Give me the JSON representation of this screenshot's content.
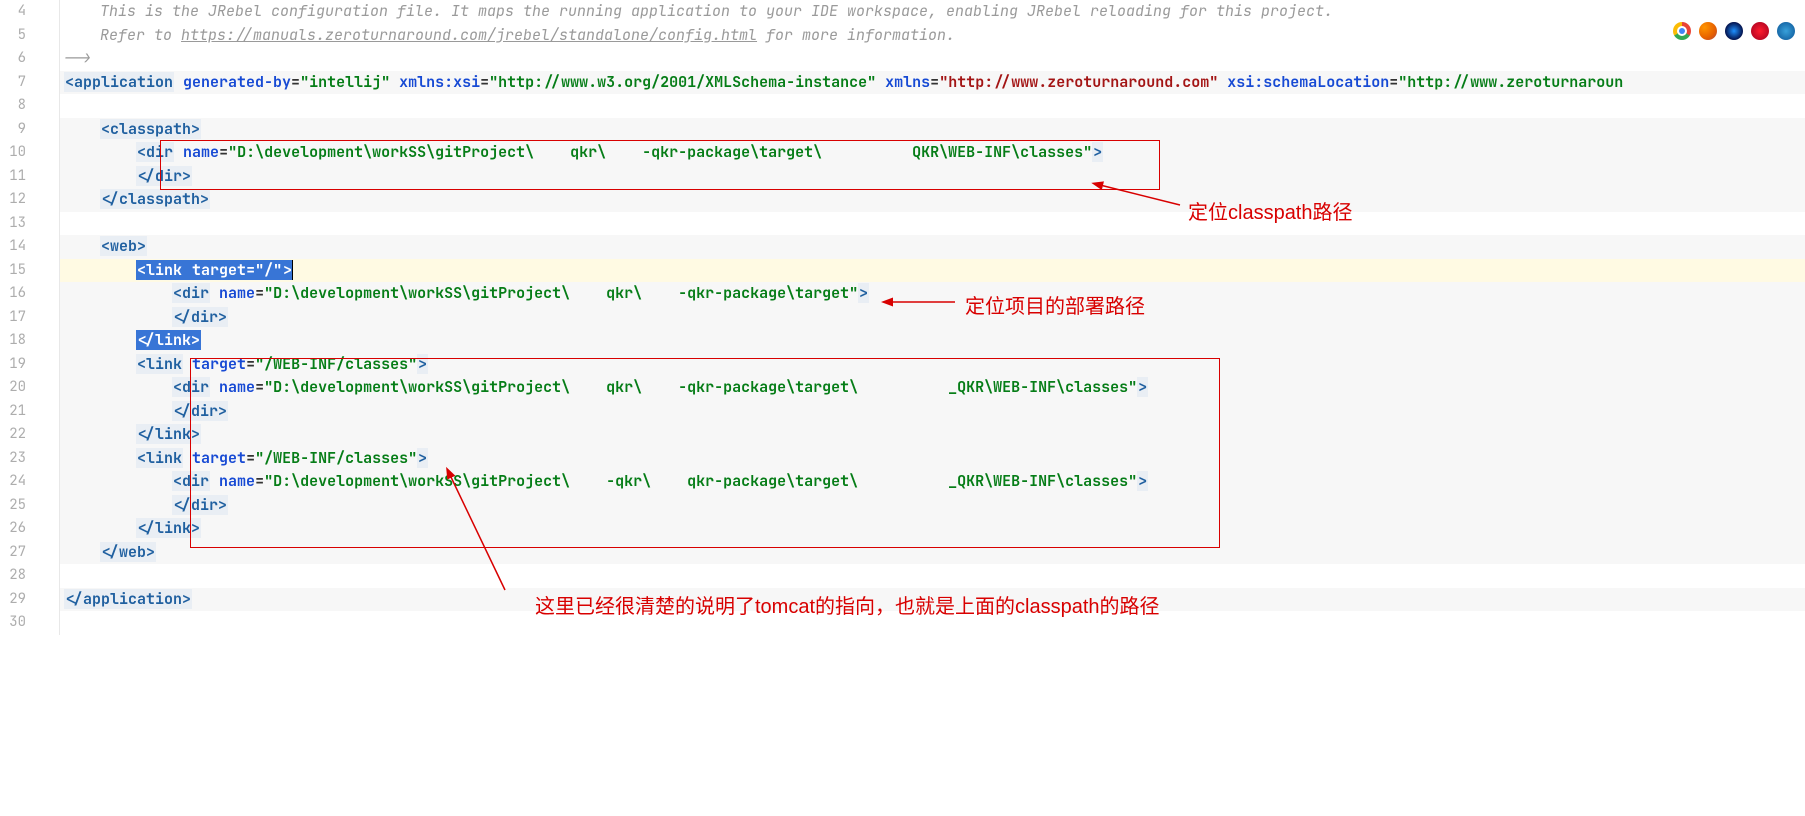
{
  "lines": {
    "start": 4,
    "end": 30
  },
  "comment": {
    "l4": "This is the JRebel configuration file. It maps the running application to your IDE workspace, enabling JRebel reloading for this project.",
    "l5a": "Refer to ",
    "l5link": "https://manuals.zeroturnaround.com/jrebel/standalone/config.html",
    "l5b": " for more information.",
    "l6": "-->"
  },
  "app": {
    "open": "<application",
    "gen_attr": "generated-by",
    "gen_val": "\"intellij\"",
    "xsi_attr": "xmlns:xsi",
    "xsi_val": "\"http://www.w3.org/2001/XMLSchema-instance\"",
    "xmlns_attr": "xmlns",
    "xmlns_val": "\"http://www.zeroturnaround.com\"",
    "loc_attr": "xsi:schemaLocation",
    "loc_val": "\"http://www.zeroturnaroun",
    "close": "</application>"
  },
  "cp": {
    "open": "<classpath>",
    "close": "</classpath>",
    "dir_open": "<dir",
    "name_attr": "name",
    "name_val": "\"D:\\development\\workSS\\gitProject\\    qkr\\    -qkr-package\\target\\          QKR\\WEB-INF\\classes\"",
    "dir_end": ">",
    "dir_close": "</dir>"
  },
  "web": {
    "open": "<web>",
    "close": "</web>",
    "link1_open": "<link",
    "target_attr": "target",
    "t1": "\"/\"",
    "gt": ">",
    "dir_open": "<dir",
    "name_attr": "name",
    "d16": "\"D:\\development\\workSS\\gitProject\\    qkr\\    -qkr-package\\target\"",
    "dir_close": "</dir>",
    "link_close": "</link>",
    "t2": "\"/WEB-INF/classes\"",
    "d20": "\"D:\\development\\workSS\\gitProject\\    qkr\\    -qkr-package\\target\\          _QKR\\WEB-INF\\classes\"",
    "t3": "\"/WEB-INF/classes\"",
    "d24": "\"D:\\development\\workSS\\gitProject\\    -qkr\\    qkr-package\\target\\          _QKR\\WEB-INF\\classes\""
  },
  "anno": {
    "a1": "定位classpath路径",
    "a2": "定位项目的部署路径",
    "a3": "这里已经很清楚的说明了tomcat的指向，也就是上面的classpath的路径"
  }
}
